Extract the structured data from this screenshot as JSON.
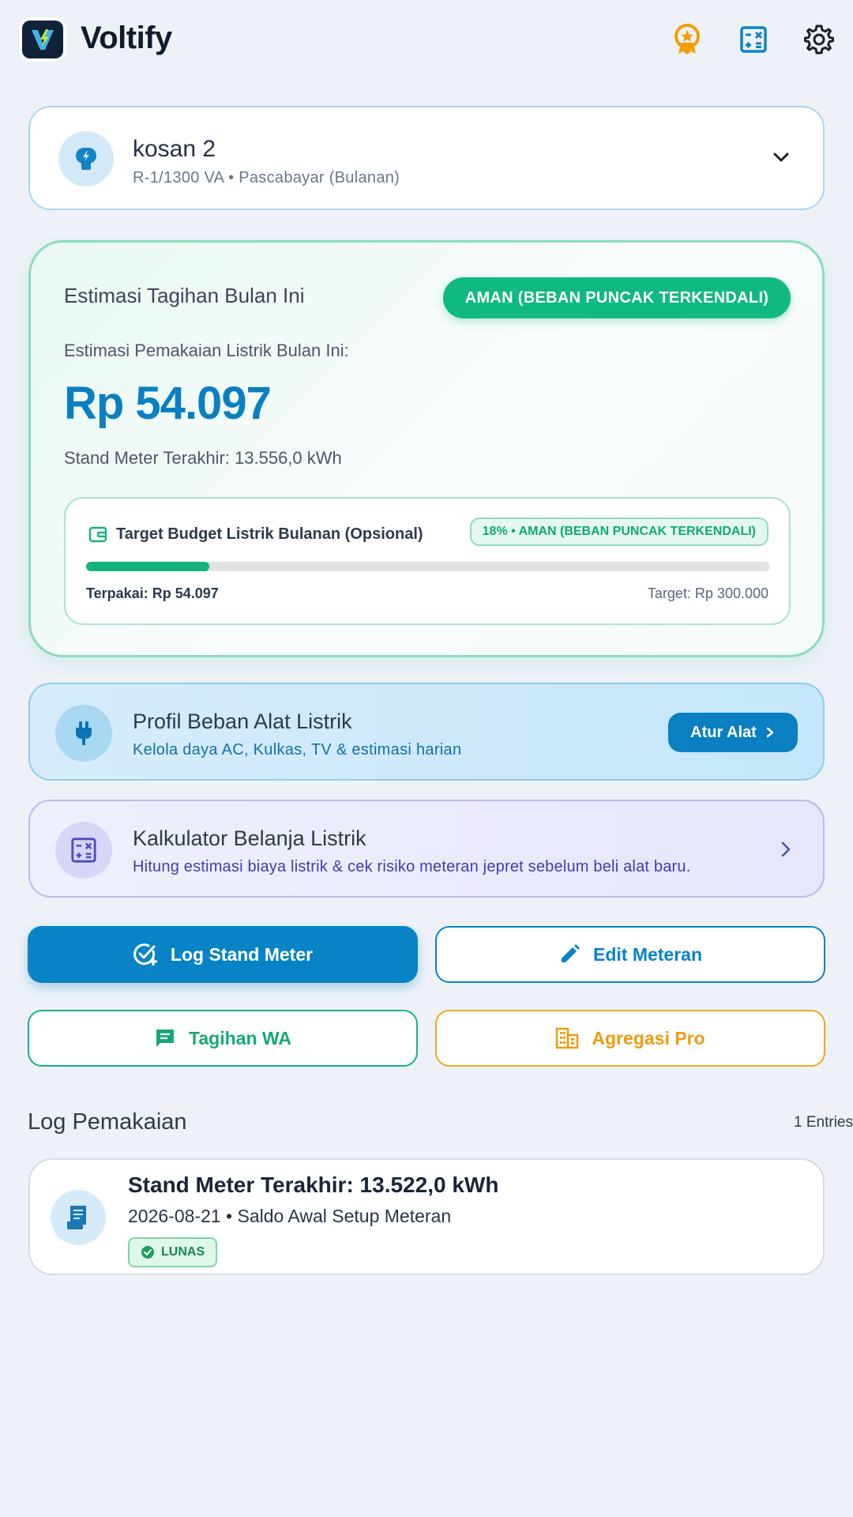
{
  "app": {
    "title": "Voltify"
  },
  "meter": {
    "name": "kosan 2",
    "details": "R-1/1300 VA • Pascabayar (Bulanan)"
  },
  "estimate": {
    "title": "Estimasi Tagihan Bulan Ini",
    "status": "AMAN (BEBAN PUNCAK TERKENDALI)",
    "label": "Estimasi Pemakaian Listrik Bulan Ini:",
    "amount": "Rp 54.097",
    "stand": "Stand Meter Terakhir: 13.556,0 kWh",
    "budget": {
      "title": "Target Budget Listrik Bulanan (Opsional)",
      "badge": "18% • AMAN (BEBAN PUNCAK TERKENDALI)",
      "progress_percent": 18,
      "used": "Terpakai: Rp 54.097",
      "target": "Target: Rp 300.000"
    }
  },
  "profile_card": {
    "title": "Profil Beban Alat Listrik",
    "subtitle": "Kelola daya AC, Kulkas, TV & estimasi harian",
    "button": "Atur Alat"
  },
  "calc_card": {
    "title": "Kalkulator Belanja Listrik",
    "subtitle": "Hitung estimasi biaya listrik & cek risiko meteran jepret sebelum beli alat baru."
  },
  "actions": {
    "log": "Log Stand Meter",
    "edit": "Edit Meteran",
    "wa": "Tagihan WA",
    "pro": "Agregasi Pro"
  },
  "log": {
    "title": "Log Pemakaian",
    "count": "1 Entries",
    "entries": [
      {
        "main": "Stand Meter Terakhir: 13.522,0 kWh",
        "sub": "2026-08-21 • Saldo Awal Setup Meteran",
        "badge": "LUNAS"
      }
    ]
  },
  "colors": {
    "primary": "#0883c6",
    "success": "#10b981",
    "warning": "#f2a81d",
    "background": "#eef2f8"
  }
}
